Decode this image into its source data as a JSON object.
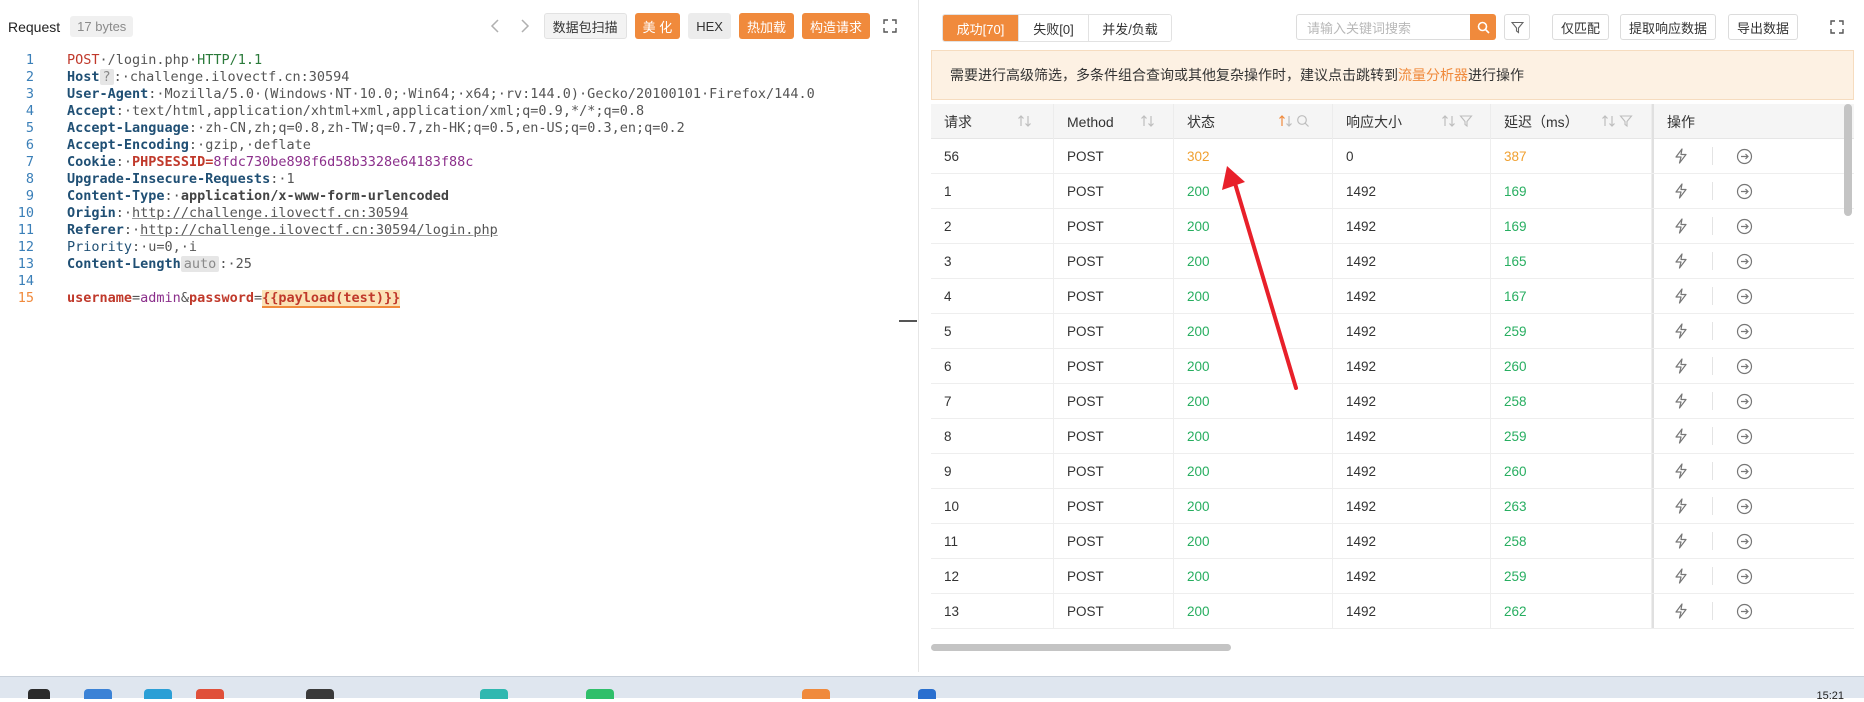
{
  "request_panel": {
    "title": "Request",
    "size": "17 bytes",
    "buttons": [
      "数据包扫描",
      "美 化",
      "HEX",
      "热加载",
      "构造请求"
    ],
    "host_tag": "?",
    "auto_tag": "auto"
  },
  "request_lines": [
    {
      "n": "1",
      "method": "POST",
      "path": "/login.php",
      "proto": "HTTP/1.1"
    },
    {
      "n": "2",
      "name": "Host",
      "value": "challenge.ilovectf.cn:30594"
    },
    {
      "n": "3",
      "name": "User-Agent",
      "value": "Mozilla/5.0·(Windows·NT·10.0;·Win64;·x64;·rv:144.0)·Gecko/20100101·Firefox/144.0"
    },
    {
      "n": "4",
      "name": "Accept",
      "value": "text/html,application/xhtml+xml,application/xml;q=0.9,*/*;q=0.8"
    },
    {
      "n": "5",
      "name": "Accept-Language",
      "value": "zh-CN,zh;q=0.8,zh-TW;q=0.7,zh-HK;q=0.5,en-US;q=0.3,en;q=0.2"
    },
    {
      "n": "6",
      "name": "Accept-Encoding",
      "value": "gzip,·deflate"
    },
    {
      "n": "7",
      "name": "Cookie",
      "cookie_name": "PHPSESSID",
      "cookie_value": "8fdc730be898f6d58b3328e64183f88c"
    },
    {
      "n": "8",
      "name": "Upgrade-Insecure-Requests",
      "value": "1"
    },
    {
      "n": "9",
      "name": "Content-Type",
      "value": "application/x-www-form-urlencoded"
    },
    {
      "n": "10",
      "name": "Origin",
      "value": "http://challenge.ilovectf.cn:30594"
    },
    {
      "n": "11",
      "name": "Referer",
      "value": "http://challenge.ilovectf.cn:30594/login.php"
    },
    {
      "n": "12",
      "name": "Priority",
      "value": "u=0,·i"
    },
    {
      "n": "13",
      "name": "Content-Length",
      "value": "25"
    },
    {
      "n": "14"
    },
    {
      "n": "15",
      "p1": "username",
      "v1": "admin",
      "p2": "password",
      "payload": "{{payload(test)}}"
    }
  ],
  "results": {
    "tabs": [
      "成功[70]",
      "失败[0]",
      "并发/负载"
    ],
    "search_placeholder": "请输入关键词搜索",
    "buttons": [
      "仅匹配",
      "提取响应数据",
      "导出数据"
    ],
    "notice_before": "需要进行高级筛选，多条件组合查询或其他复杂操作时，建议点击跳转到",
    "notice_link": "流量分析器",
    "notice_after": "进行操作",
    "columns": [
      "请求",
      "Method",
      "状态",
      "响应大小",
      "延迟（ms）",
      "操作"
    ],
    "rows": [
      {
        "id": "56",
        "method": "POST",
        "status": "302",
        "size": "0",
        "delay": "387"
      },
      {
        "id": "1",
        "method": "POST",
        "status": "200",
        "size": "1492",
        "delay": "169"
      },
      {
        "id": "2",
        "method": "POST",
        "status": "200",
        "size": "1492",
        "delay": "169"
      },
      {
        "id": "3",
        "method": "POST",
        "status": "200",
        "size": "1492",
        "delay": "165"
      },
      {
        "id": "4",
        "method": "POST",
        "status": "200",
        "size": "1492",
        "delay": "167"
      },
      {
        "id": "5",
        "method": "POST",
        "status": "200",
        "size": "1492",
        "delay": "259"
      },
      {
        "id": "6",
        "method": "POST",
        "status": "200",
        "size": "1492",
        "delay": "260"
      },
      {
        "id": "7",
        "method": "POST",
        "status": "200",
        "size": "1492",
        "delay": "258"
      },
      {
        "id": "8",
        "method": "POST",
        "status": "200",
        "size": "1492",
        "delay": "259"
      },
      {
        "id": "9",
        "method": "POST",
        "status": "200",
        "size": "1492",
        "delay": "260"
      },
      {
        "id": "10",
        "method": "POST",
        "status": "200",
        "size": "1492",
        "delay": "263"
      },
      {
        "id": "11",
        "method": "POST",
        "status": "200",
        "size": "1492",
        "delay": "258"
      },
      {
        "id": "12",
        "method": "POST",
        "status": "200",
        "size": "1492",
        "delay": "259"
      },
      {
        "id": "13",
        "method": "POST",
        "status": "200",
        "size": "1492",
        "delay": "262"
      }
    ]
  },
  "taskbar": {
    "time": "15:21"
  },
  "colors": {
    "accent": "#f08a3c",
    "ok": "#27ae60",
    "redirect": "#f0a030",
    "arrow": "#e8202a"
  },
  "icons": [
    "chevron-left-icon",
    "chevron-right-icon",
    "expand-icon",
    "search-icon",
    "filter-icon",
    "sort-icon",
    "lightning-icon",
    "arrow-circle-right-icon"
  ]
}
